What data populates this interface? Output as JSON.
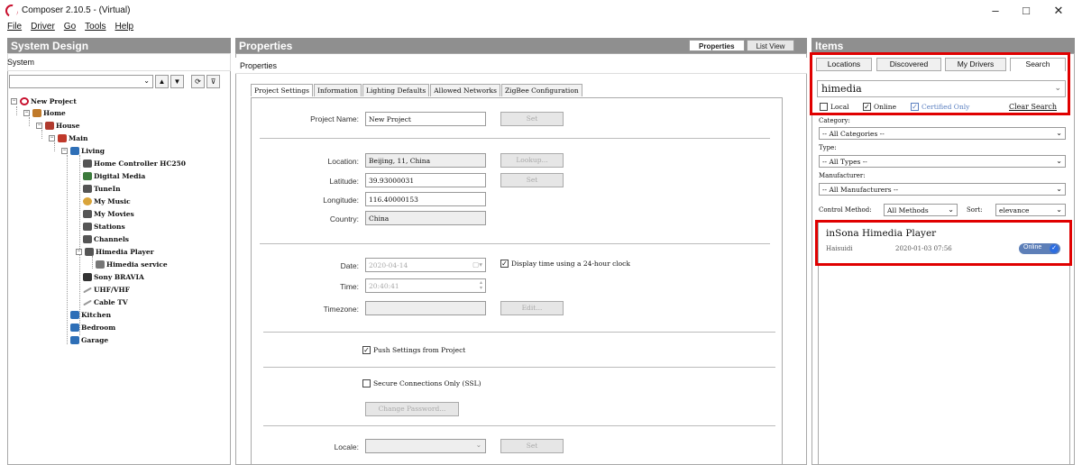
{
  "window": {
    "title": "Composer 2.10.5 - (Virtual)",
    "minimize": "–",
    "maximize": "□",
    "close": "✕"
  },
  "menu": [
    "File",
    "Driver",
    "Go",
    "Tools",
    "Help"
  ],
  "system_design": {
    "title": "System Design",
    "subtitle": "System",
    "combo_value": "",
    "tree": [
      {
        "label": "New Project",
        "color": "#c8102e"
      },
      {
        "label": "Home",
        "color": "#c07a2a"
      },
      {
        "label": "House",
        "color": "#b03a2e"
      },
      {
        "label": "Main",
        "color": "#c0392b"
      },
      {
        "label": "Living",
        "color": "#2e6fb7"
      },
      {
        "label": "Home Controller HC250",
        "color": "#555555"
      },
      {
        "label": "Digital Media",
        "color": "#3b7a3b"
      },
      {
        "label": "TuneIn",
        "color": "#555555"
      },
      {
        "label": "My Music",
        "color": "#d9a43a"
      },
      {
        "label": "My Movies",
        "color": "#555555"
      },
      {
        "label": "Stations",
        "color": "#555555"
      },
      {
        "label": "Channels",
        "color": "#555555"
      },
      {
        "label": "Himedia Player",
        "color": "#555555"
      },
      {
        "label": "Himedia service",
        "color": "#777777"
      },
      {
        "label": "Sony BRAVIA",
        "color": "#333333"
      },
      {
        "label": "UHF/VHF",
        "color": "#999999"
      },
      {
        "label": "Cable TV",
        "color": "#999999"
      },
      {
        "label": "Kitchen",
        "color": "#2e6fb7"
      },
      {
        "label": "Bedroom",
        "color": "#2e6fb7"
      },
      {
        "label": "Garage",
        "color": "#2e6fb7"
      }
    ]
  },
  "properties": {
    "title": "Properties",
    "view_tabs": [
      "Properties",
      "List View"
    ],
    "subtitle": "Properties",
    "tabs": [
      "Project Settings",
      "Information",
      "Lighting Defaults",
      "Allowed Networks",
      "ZigBee Configuration"
    ],
    "project_name_label": "Project Name:",
    "project_name": "New Project",
    "set_label": "Set",
    "location_label": "Location:",
    "location": "Beijing, 11, China",
    "lookup_label": "Lookup...",
    "latitude_label": "Latitude:",
    "latitude": "39.93000031",
    "longitude_label": "Longitude:",
    "longitude": "116.40000153",
    "country_label": "Country:",
    "country": "China",
    "date_label": "Date:",
    "date": "2020-04-14",
    "display_24h": "Display time using a 24-hour clock",
    "time_label": "Time:",
    "time": "20:40:41",
    "timezone_label": "Timezone:",
    "timezone": "",
    "edit_label": "Edit...",
    "push_settings": "Push Settings from Project",
    "secure_ssl": "Secure Connections Only (SSL)",
    "change_password": "Change Password...",
    "locale_label": "Locale:",
    "locale": ""
  },
  "items": {
    "title": "Items",
    "tabs": [
      "Locations",
      "Discovered",
      "My Drivers",
      "Search"
    ],
    "search_value": "himedia",
    "filters": [
      "Local",
      "Online",
      "Certified Only"
    ],
    "clear_search": "Clear Search",
    "category_label": "Category:",
    "category": "-- All Categories --",
    "type_label": "Type:",
    "type": "-- All Types --",
    "manufacturer_label": "Manufacturer:",
    "manufacturer": "-- All Manufacturers --",
    "control_method_label": "Control Method:",
    "control_method": "All Methods",
    "sort_label": "Sort:",
    "sort": "elevance",
    "result": {
      "name": "inSona Himedia Player",
      "maker": "Haisuidi",
      "date": "2020-01-03 07:56",
      "badge": "Online"
    }
  },
  "colors": {
    "highlight": "#e00000",
    "header": "#8f8f8f",
    "badge": "#5d7fb8"
  }
}
